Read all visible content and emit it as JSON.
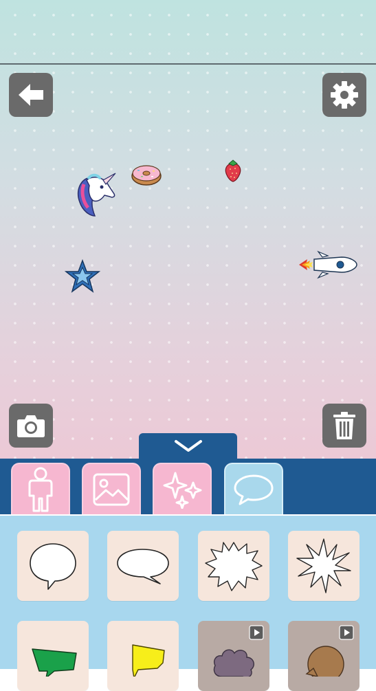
{
  "toolbar": {
    "back": {
      "icon": "back-arrow-icon"
    },
    "settings": {
      "icon": "gear-icon"
    },
    "camera": {
      "icon": "camera-icon"
    },
    "trash": {
      "icon": "trash-icon"
    }
  },
  "stickers": [
    {
      "name": "unicorn-sticker"
    },
    {
      "name": "donut-sticker"
    },
    {
      "name": "strawberry-sticker"
    },
    {
      "name": "star-sticker"
    },
    {
      "name": "rocket-sticker"
    }
  ],
  "panel_toggle": {
    "icon": "chevron-down-icon"
  },
  "tabs": [
    {
      "icon": "person-icon",
      "active": false
    },
    {
      "icon": "image-icon",
      "active": false
    },
    {
      "icon": "sparkle-icon",
      "active": false
    },
    {
      "icon": "speech-bubble-icon",
      "active": true
    }
  ],
  "items": [
    {
      "icon": "round-speech-bubble-icon",
      "locked": false
    },
    {
      "icon": "oval-speech-bubble-icon",
      "locked": false
    },
    {
      "icon": "spiky-bubble-icon",
      "locked": false
    },
    {
      "icon": "burst-bubble-icon",
      "locked": false
    },
    {
      "icon": "green-banner-bubble-icon",
      "locked": false
    },
    {
      "icon": "yellow-banner-bubble-icon",
      "locked": false
    },
    {
      "icon": "cloud-bubble-icon",
      "locked": true
    },
    {
      "icon": "brown-bubble-icon",
      "locked": true
    }
  ],
  "colors": {
    "accent": "#1f5a92",
    "tab_pink": "#f6b7d0",
    "tab_active": "#a9d8ec",
    "panel": "#a8d7ee",
    "card": "#f6e6dc",
    "button": "#6a6a6a"
  }
}
